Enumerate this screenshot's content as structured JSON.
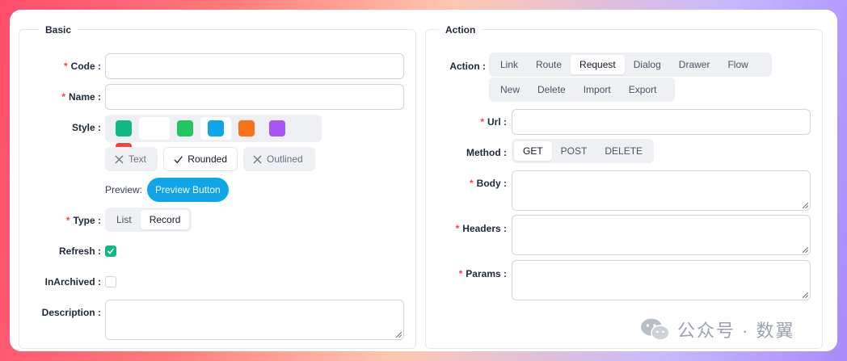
{
  "basic": {
    "legend": "Basic",
    "code_label": "Code :",
    "name_label": "Name :",
    "style_label": "Style :",
    "swatches": [
      "#10b981",
      "#22c55e",
      "#0ea5e9",
      "#f97316",
      "#a855f7",
      "#ef4444"
    ],
    "variants": [
      "Text",
      "Rounded",
      "Outlined"
    ],
    "preview_label": "Preview:",
    "preview_button": "Preview Button",
    "type_label": "Type :",
    "type_options": [
      "List",
      "Record"
    ],
    "refresh_label": "Refresh :",
    "inarchived_label": "InArchived :",
    "description_label": "Description :"
  },
  "action": {
    "legend": "Action",
    "action_label": "Action :",
    "action_options": [
      "Link",
      "Route",
      "Request",
      "Dialog",
      "Drawer",
      "Flow",
      "New",
      "Delete",
      "Import",
      "Export"
    ],
    "url_label": "Url :",
    "method_label": "Method :",
    "method_options": [
      "GET",
      "POST",
      "DELETE"
    ],
    "body_label": "Body :",
    "headers_label": "Headers :",
    "params_label": "Params :"
  },
  "required_mark": "*",
  "watermark": {
    "text": "公众号 · 数翼"
  }
}
